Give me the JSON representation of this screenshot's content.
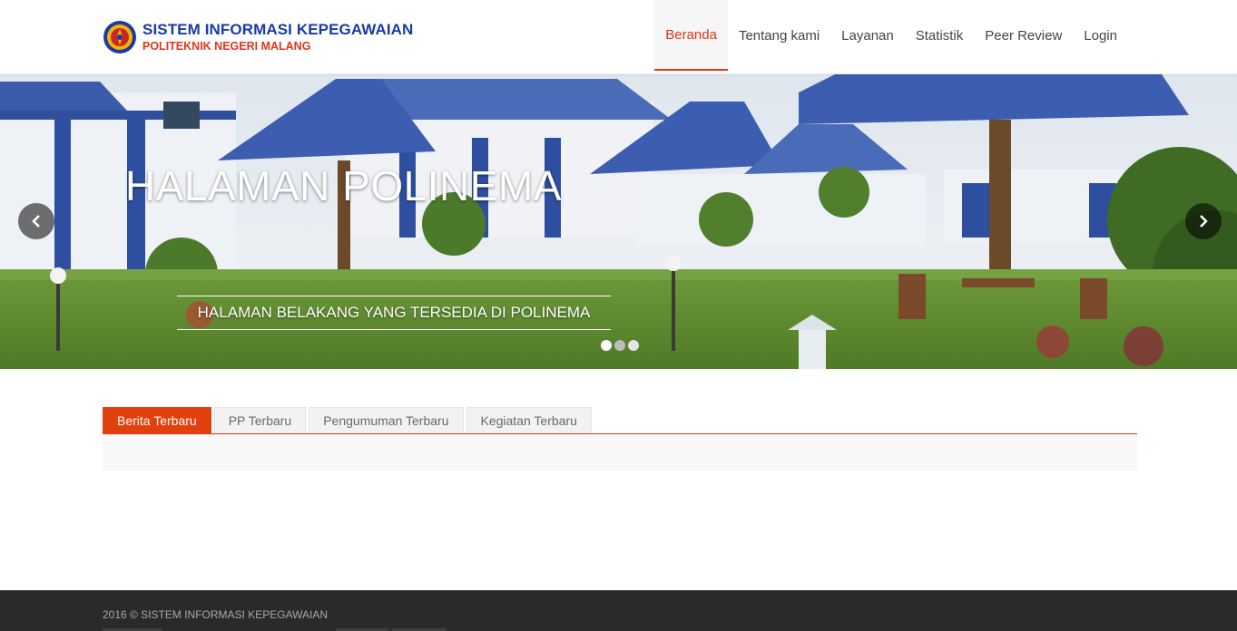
{
  "brand": {
    "title": "SISTEM INFORMASI KEPEGAWAIAN",
    "subtitle": "POLITEKNIK NEGERI MALANG",
    "logo_icon": "polinema-seal-icon"
  },
  "nav": {
    "items": [
      {
        "label": "Beranda",
        "active": true
      },
      {
        "label": "Tentang kami",
        "active": false
      },
      {
        "label": "Layanan",
        "active": false
      },
      {
        "label": "Statistik",
        "active": false
      },
      {
        "label": "Peer Review",
        "active": false
      },
      {
        "label": "Login",
        "active": false
      }
    ]
  },
  "carousel": {
    "title": "HALAMAN POLINEMA",
    "caption": "HALAMAN BELAKANG YANG TERSEDIA DI POLINEMA",
    "prev_icon": "chevron-left-icon",
    "next_icon": "chevron-right-icon",
    "indicator_count": 3
  },
  "tabs": {
    "items": [
      {
        "label": "Berita Terbaru",
        "active": true
      },
      {
        "label": "PP Terbaru",
        "active": false
      },
      {
        "label": "Pengumuman Terbaru",
        "active": false
      },
      {
        "label": "Kegiatan Terbaru",
        "active": false
      }
    ]
  },
  "footer": {
    "copyright": "2016 © SISTEM INFORMASI KEPEGAWAIAN"
  },
  "colors": {
    "accent": "#e0361a",
    "brand_blue": "#1a3aa6",
    "footer_bg": "#2a2a2a"
  }
}
